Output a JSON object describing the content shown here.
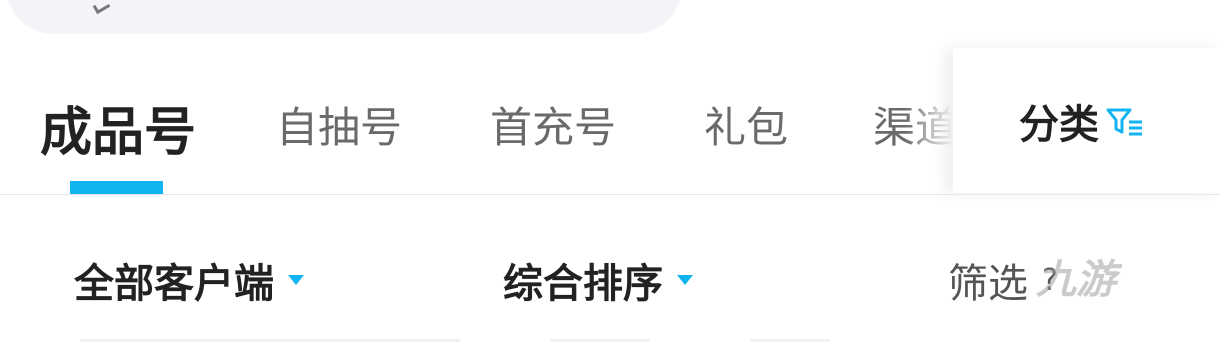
{
  "search": {
    "icon": "search-icon"
  },
  "tabs": {
    "items": [
      {
        "label": "成品号",
        "active": true
      },
      {
        "label": "自抽号",
        "active": false
      },
      {
        "label": "首充号",
        "active": false
      },
      {
        "label": "礼包",
        "active": false
      },
      {
        "label": "渠道",
        "active": false
      }
    ],
    "category_label": "分类",
    "category_icon": "filter-list-icon",
    "accent": "#10b4f0"
  },
  "filters": {
    "client_label": "全部客户端",
    "sort_label": "综合排序",
    "screen_label": "筛选",
    "screen_icon_text": "?",
    "watermark": "九游"
  }
}
